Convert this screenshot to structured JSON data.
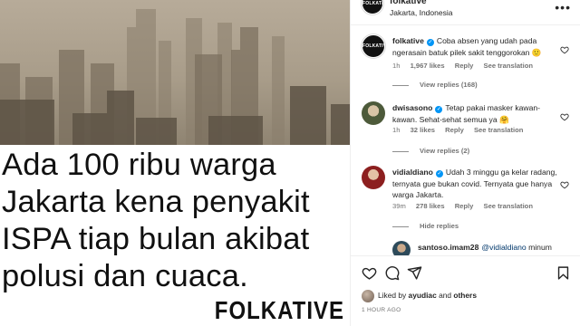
{
  "post": {
    "headline": "Ada 100 ribu warga\nJakarta kena penyakit\nISPA tiap bulan akibat\npolusi dan cuaca.",
    "brand_mark": "FOLKATIVE",
    "photo": "hazy-jakarta-skyline"
  },
  "header": {
    "username": "folkative",
    "verified": true,
    "location": "Jakarta, Indonesia",
    "avatar_text": "FOLKATIVE",
    "more_icon": "more-horizontal-icon"
  },
  "comments": [
    {
      "username": "folkative",
      "verified": true,
      "text": "Coba absen yang udah pada ngerasain batuk pilek sakit tenggorokan 🙂",
      "time": "1h",
      "likes": "1,967 likes",
      "reply": "Reply",
      "translate": "See translation",
      "replies_toggle": "View replies (168)"
    },
    {
      "username": "dwisasono",
      "verified": true,
      "text": "Tetap pakai masker kawan-kawan. Sehat-sehat semua ya 🤗",
      "time": "1h",
      "likes": "32 likes",
      "reply": "Reply",
      "translate": "See translation",
      "replies_toggle": "View replies (2)"
    },
    {
      "username": "vidialdiano",
      "verified": true,
      "text": "Udah 3 minggu ga kelar radang, ternyata gue bukan covid. Ternyata gue hanya warga Jakarta.",
      "time": "39m",
      "likes": "278 likes",
      "reply": "Reply",
      "translate": "See translation",
      "replies_toggle": "Hide replies"
    },
    {
      "username": "santoso.imam28",
      "mention": "@vidialdiano",
      "text": "minum"
    }
  ],
  "actions": {
    "like_icon": "heart-icon",
    "comment_icon": "comment-icon",
    "share_icon": "send-icon",
    "save_icon": "bookmark-icon"
  },
  "likes_summary": {
    "prefix": "Liked by",
    "user": "ayudiac",
    "middle": "and",
    "others": "others"
  },
  "time_ago": "1 HOUR AGO",
  "colors": {
    "verified": "#0095f6",
    "meta_text": "#737373",
    "mention": "#00376b"
  }
}
